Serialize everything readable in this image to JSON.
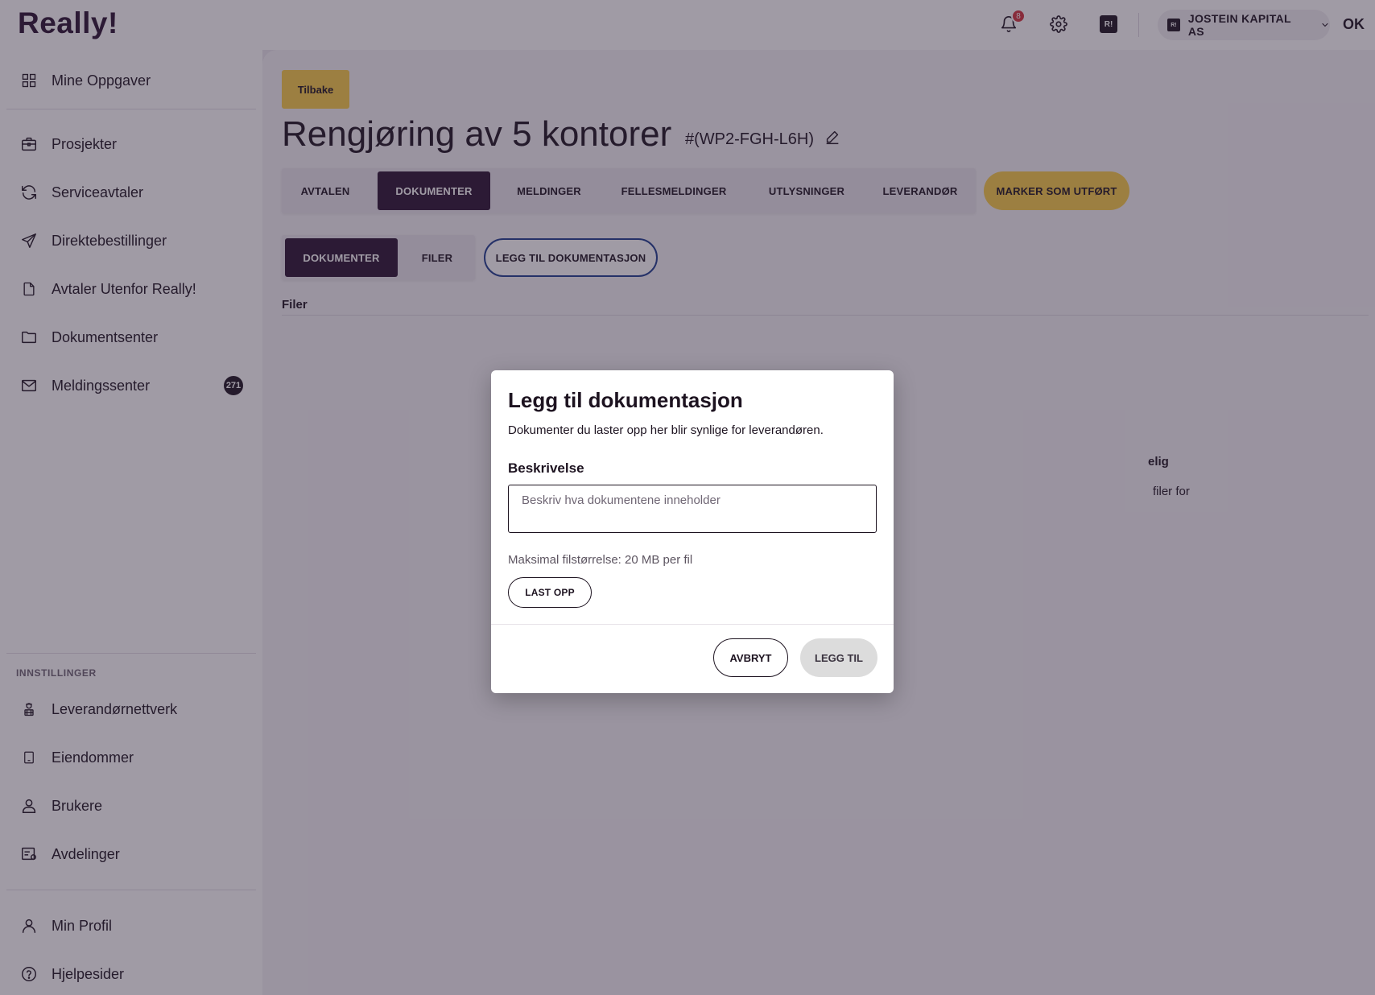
{
  "app": {
    "logo": "Really!"
  },
  "topbar": {
    "notification_count": "8",
    "brand_badge": "R!",
    "company_badge": "R!",
    "company_name": "JOSTEIN KAPITAL AS",
    "user_initials": "OK"
  },
  "sidebar": {
    "top_items": [
      {
        "label": "Mine Oppgaver",
        "icon": "grid-icon"
      }
    ],
    "main_items": [
      {
        "label": "Prosjekter",
        "icon": "briefcase-icon"
      },
      {
        "label": "Serviceavtaler",
        "icon": "refresh-icon"
      },
      {
        "label": "Direktebestillinger",
        "icon": "send-icon"
      },
      {
        "label": "Avtaler Utenfor Really!",
        "icon": "document-icon"
      },
      {
        "label": "Dokumentsenter",
        "icon": "folder-icon"
      },
      {
        "label": "Meldingssenter",
        "icon": "mail-icon",
        "badge": "271"
      }
    ],
    "settings_heading": "INNSTILLINGER",
    "settings_items": [
      {
        "label": "Leverandørnettverk",
        "icon": "worker-icon"
      },
      {
        "label": "Eiendommer",
        "icon": "building-icon"
      },
      {
        "label": "Brukere",
        "icon": "user-icon"
      },
      {
        "label": "Avdelinger",
        "icon": "departments-icon"
      }
    ],
    "bottom_items": [
      {
        "label": "Min Profil",
        "icon": "profile-icon"
      },
      {
        "label": "Hjelpesider",
        "icon": "help-icon"
      }
    ]
  },
  "main": {
    "back_label": "Tilbake",
    "title": "Rengjøring av 5 kontorer",
    "code": "#(WP2-FGH-L6H)",
    "tabs": [
      {
        "label": "AVTALEN",
        "active": false
      },
      {
        "label": "DOKUMENTER",
        "active": true
      },
      {
        "label": "MELDINGER",
        "active": false
      },
      {
        "label": "FELLESMELDINGER",
        "active": false
      },
      {
        "label": "UTLYSNINGER",
        "active": false
      },
      {
        "label": "LEVERANDØR",
        "active": false
      }
    ],
    "mark_done_label": "MARKER SOM UTFØRT",
    "subtabs": [
      {
        "label": "DOKUMENTER",
        "active": true
      },
      {
        "label": "FILER",
        "active": false
      }
    ],
    "add_doc_label": "LEGG TIL DOKUMENTASJON",
    "section_label": "Filer",
    "empty_title_fragment": "elig",
    "empty_text_fragment": "filer for"
  },
  "modal": {
    "title": "Legg til dokumentasjon",
    "subtitle": "Dokumenter du laster opp her blir synlige for leverandøren.",
    "field_label": "Beskrivelse",
    "field_value": "",
    "field_placeholder": "Beskriv hva dokumentene inneholder",
    "max_size_text": "Maksimal filstørrelse: 20 MB per fil",
    "upload_label": "LAST OPP",
    "cancel_label": "AVBRYT",
    "submit_label": "LEGG TIL"
  },
  "colors": {
    "accent_yellow": "#f8cc46",
    "brand_dark": "#2a1230",
    "badge_red": "#d2323b",
    "outline_blue": "#1d3c8f"
  }
}
